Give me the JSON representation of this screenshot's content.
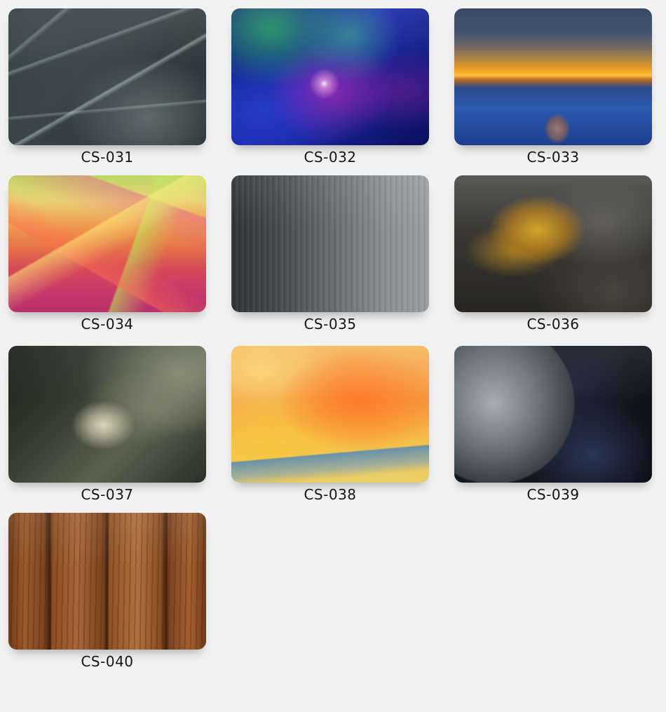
{
  "swatches": [
    {
      "code": "CS-031"
    },
    {
      "code": "CS-032"
    },
    {
      "code": "CS-033"
    },
    {
      "code": "CS-034"
    },
    {
      "code": "CS-035"
    },
    {
      "code": "CS-036"
    },
    {
      "code": "CS-037"
    },
    {
      "code": "CS-038"
    },
    {
      "code": "CS-039"
    },
    {
      "code": "CS-040"
    }
  ]
}
